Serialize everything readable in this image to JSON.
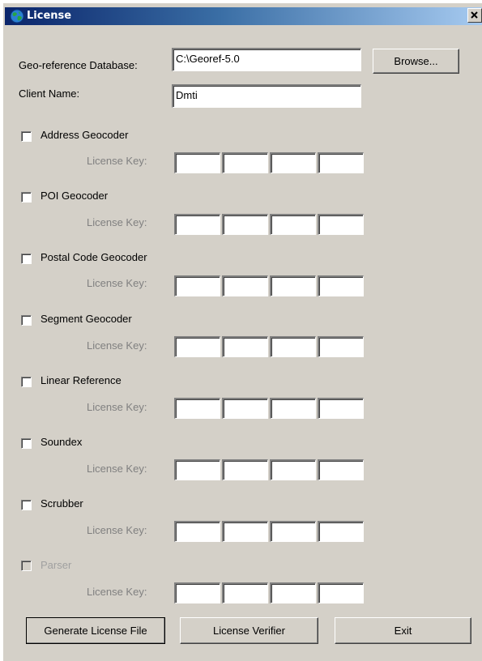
{
  "window": {
    "title": "License",
    "close_symbol": "✕"
  },
  "geo_db": {
    "label": "Geo-reference Database:",
    "value": "C:\\Georef-5.0"
  },
  "browse_button": {
    "label": "Browse..."
  },
  "client": {
    "label": "Client Name:",
    "value": "Dmti"
  },
  "license_key_label": "License Key:",
  "products": [
    {
      "label": "Address Geocoder",
      "checked": false,
      "enabled": true
    },
    {
      "label": "POI Geocoder",
      "checked": false,
      "enabled": true
    },
    {
      "label": "Postal Code Geocoder",
      "checked": false,
      "enabled": true
    },
    {
      "label": "Segment Geocoder",
      "checked": false,
      "enabled": true
    },
    {
      "label": "Linear Reference",
      "checked": false,
      "enabled": true
    },
    {
      "label": "Soundex",
      "checked": false,
      "enabled": true
    },
    {
      "label": "Scrubber",
      "checked": false,
      "enabled": true
    },
    {
      "label": "Parser",
      "checked": false,
      "enabled": false
    }
  ],
  "buttons": {
    "generate": "Generate License File",
    "verifier": "License Verifier",
    "exit": "Exit"
  },
  "colors": {
    "title_start": "#0a246a",
    "title_end": "#a6caf0",
    "dialog_bg": "#d4d0c8"
  }
}
